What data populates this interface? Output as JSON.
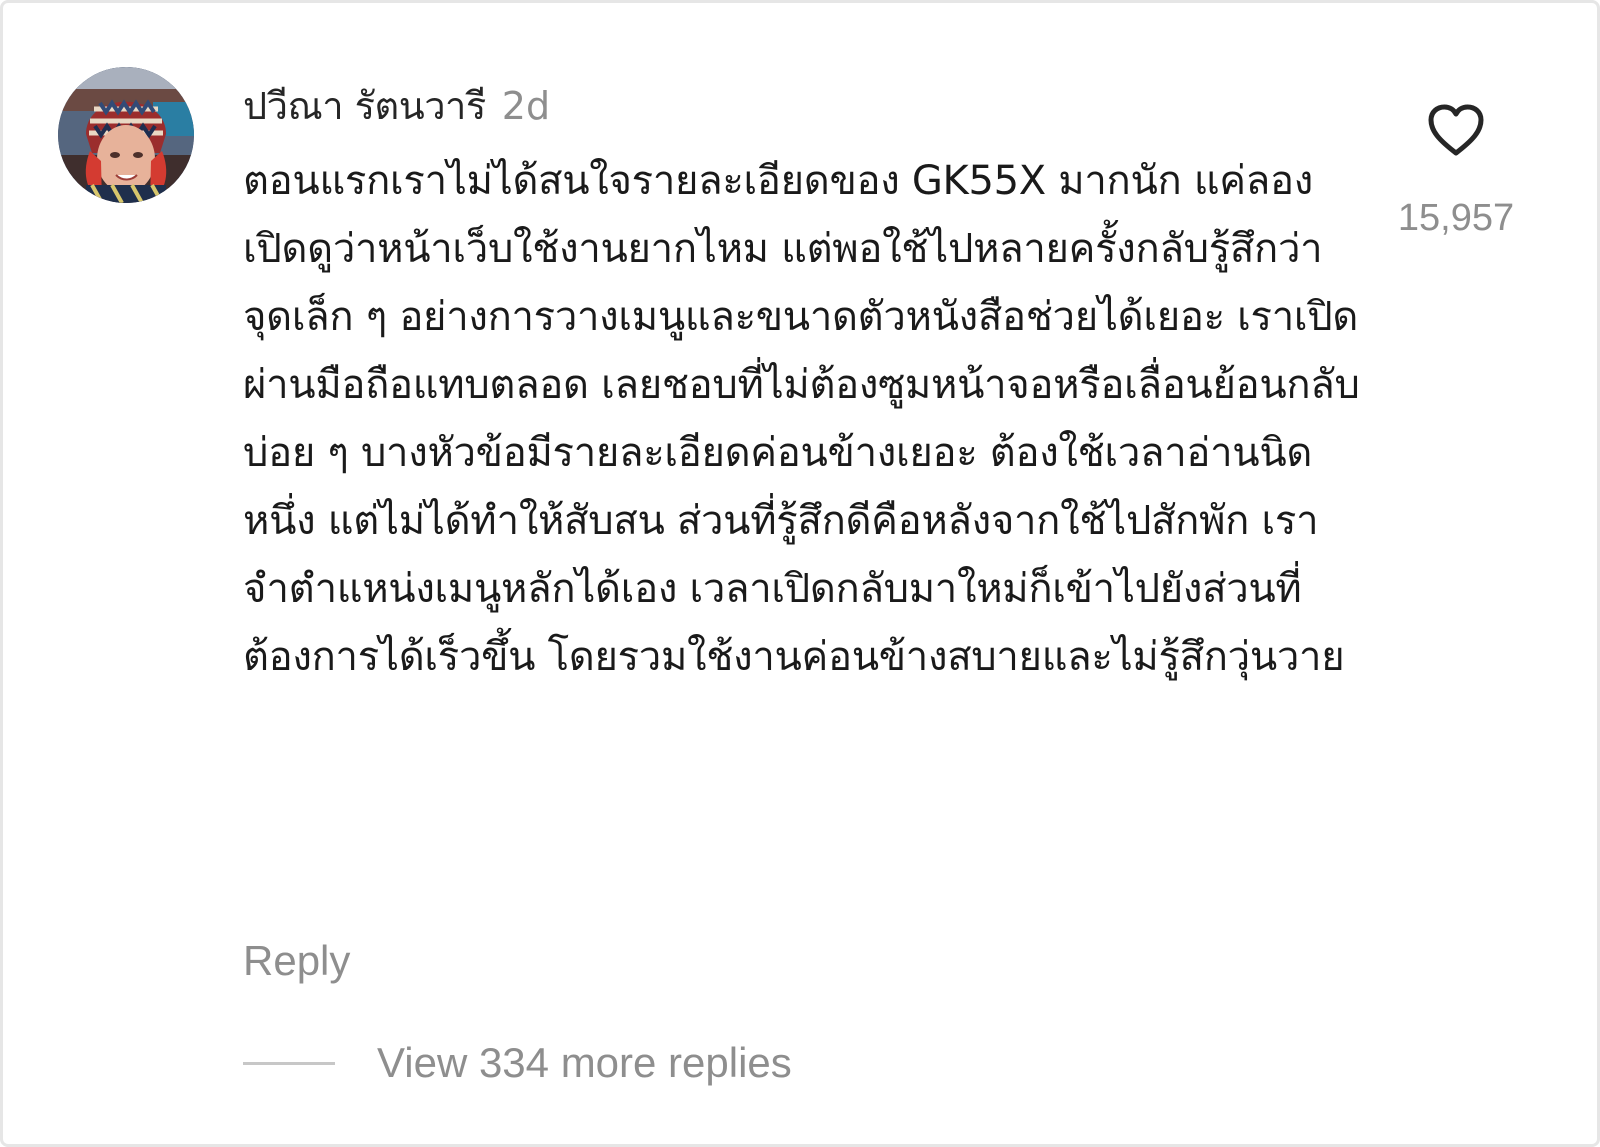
{
  "comment": {
    "author": "ปวีณา รัตนวารี",
    "time": "2d",
    "text": "ตอนแรกเราไม่ได้สนใจรายละเอียดของ GK55X มากนัก แค่ลองเปิดดูว่าหน้าเว็บใช้งานยากไหม แต่พอใช้ไปหลายครั้งกลับรู้สึกว่าจุดเล็ก ๆ อย่างการวางเมนูและขนาดตัวหนังสือช่วยได้เยอะ เราเปิดผ่านมือถือแทบตลอด เลยชอบที่ไม่ต้องซูมหน้าจอหรือเลื่อนย้อนกลับบ่อย ๆ บางหัวข้อมีรายละเอียดค่อนข้างเยอะ ต้องใช้เวลาอ่านนิดหนึ่ง แต่ไม่ได้ทำให้สับสน ส่วนที่รู้สึกดีคือหลังจากใช้ไปสักพัก เราจำตำแหน่งเมนูหลักได้เอง เวลาเปิดกลับมาใหม่ก็เข้าไปยังส่วนที่ต้องการได้เร็วขึ้น โดยรวมใช้งานค่อนข้างสบายและไม่รู้สึกวุ่นวาย",
    "reply_label": "Reply",
    "like_count": "15,957",
    "view_replies_label": "View 334 more replies"
  },
  "icons": {
    "like": "heart-outline-icon"
  },
  "colors": {
    "primary_text": "#262626",
    "secondary_text": "#8e8e8e",
    "divider": "#c7c7c7",
    "border": "#e6e6e6"
  }
}
